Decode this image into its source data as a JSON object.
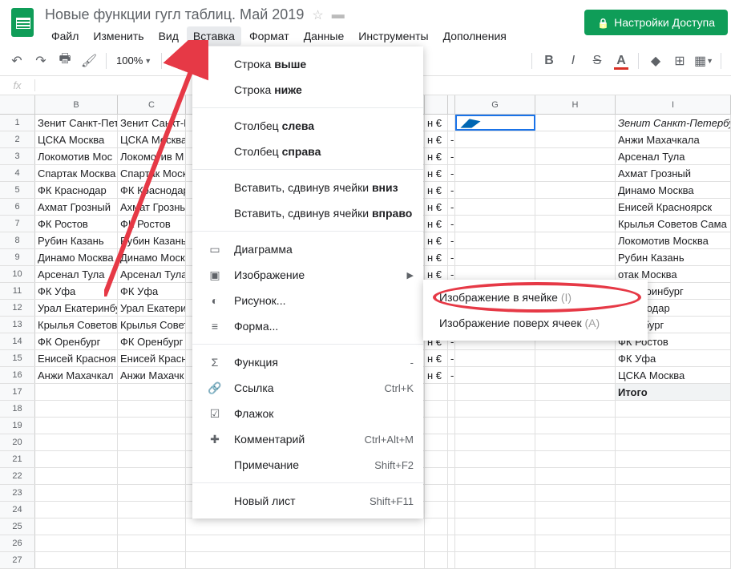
{
  "doc": {
    "title": "Новые функции гугл таблиц. Май 2019"
  },
  "menubar": [
    "Файл",
    "Изменить",
    "Вид",
    "Вставка",
    "Формат",
    "Данные",
    "Инструменты",
    "Дополнения"
  ],
  "active_menu_index": 3,
  "share_button": "Настройки Доступа",
  "toolbar": {
    "zoom": "100%"
  },
  "dropdown": {
    "items": [
      {
        "label_prefix": "Строка ",
        "label_bold": "выше"
      },
      {
        "label_prefix": "Строка ",
        "label_bold": "ниже"
      },
      null,
      {
        "label_prefix": "Столбец ",
        "label_bold": "слева"
      },
      {
        "label_prefix": "Столбец ",
        "label_bold": "справа"
      },
      null,
      {
        "label_prefix": "Вставить, сдвинув ячейки ",
        "label_bold": "вниз"
      },
      {
        "label_prefix": "Вставить, сдвинув ячейки ",
        "label_bold": "вправо"
      },
      null,
      {
        "icon": "chart",
        "label": "Диаграмма"
      },
      {
        "icon": "image",
        "label": "Изображение",
        "arrow": true
      },
      {
        "icon": "drawing",
        "label": "Рисунок..."
      },
      {
        "icon": "form",
        "label": "Форма..."
      },
      null,
      {
        "icon": "function",
        "label": "Функция",
        "shortcut": "-"
      },
      {
        "icon": "link",
        "label": "Ссылка",
        "shortcut": "Ctrl+K"
      },
      {
        "icon": "checkbox",
        "label": "Флажок"
      },
      {
        "icon": "comment",
        "label": "Комментарий",
        "shortcut": "Ctrl+Alt+M"
      },
      {
        "label": "Примечание",
        "shortcut": "Shift+F2"
      },
      null,
      {
        "label": "Новый лист",
        "shortcut": "Shift+F11"
      }
    ]
  },
  "submenu": {
    "items": [
      {
        "label": "Изображение в ячейке",
        "shortcut": "(I)"
      },
      {
        "label": "Изображение поверх ячеек",
        "shortcut": "(A)"
      }
    ]
  },
  "columns": [
    "B",
    "C",
    "",
    "",
    "",
    "G",
    "H",
    "I"
  ],
  "grid_B": [
    "Зенит Санкт-Пет",
    "ЦСКА Москва",
    "Локомотив Мос",
    "Спартак Москва",
    "ФК Краснодар",
    "Ахмат Грозный",
    "ФК Ростов",
    "Рубин Казань",
    "Динамо Москва",
    "Арсенал Тула",
    "ФК Уфа",
    "Урал Екатеринбу",
    "Крылья Советов",
    "ФК Оренбург",
    "Енисей Красноя",
    "Анжи Махачкал"
  ],
  "grid_C": [
    "Зенит Санкт-П",
    "ЦСКА Москва",
    "Локомотив М",
    "Спартак Моск",
    "ФК Краснодар",
    "Ахмат Грозны",
    "ФК Ростов",
    "Рубин Казань",
    "Динамо Моск",
    "Арсенал Тула",
    "ФК Уфа",
    "Урал Екатери",
    "Крылья Совет",
    "ФК Оренбург",
    "Енисей Красн",
    "Анжи Махачк"
  ],
  "grid_E": [
    "н €",
    "н €",
    "н €",
    "н €",
    "н €",
    "н €",
    "н €",
    "н €",
    "н €",
    "н €",
    "н €",
    "н €",
    "н €",
    "н €",
    "н €",
    "н €"
  ],
  "grid_F": [
    "",
    "-",
    "-",
    "-",
    "-",
    "-",
    "-",
    "-",
    "-",
    "-",
    "-",
    "-",
    "-",
    "-",
    "-",
    "-"
  ],
  "grid_I": [
    "Зенит Санкт-Петербург",
    "Анжи Махачкала",
    "Арсенал Тула",
    "Ахмат Грозный",
    "Динамо Москва",
    "Енисей Красноярск",
    "Крылья Советов Сама",
    "Локомотив Москва",
    "Рубин Казань",
    "отак Москва",
    "Екатеринбург",
    "Краснодар",
    "Оренбург",
    "ФК Ростов",
    "ФК Уфа",
    "ЦСКА Москва",
    "Итого"
  ],
  "row_count": 27
}
